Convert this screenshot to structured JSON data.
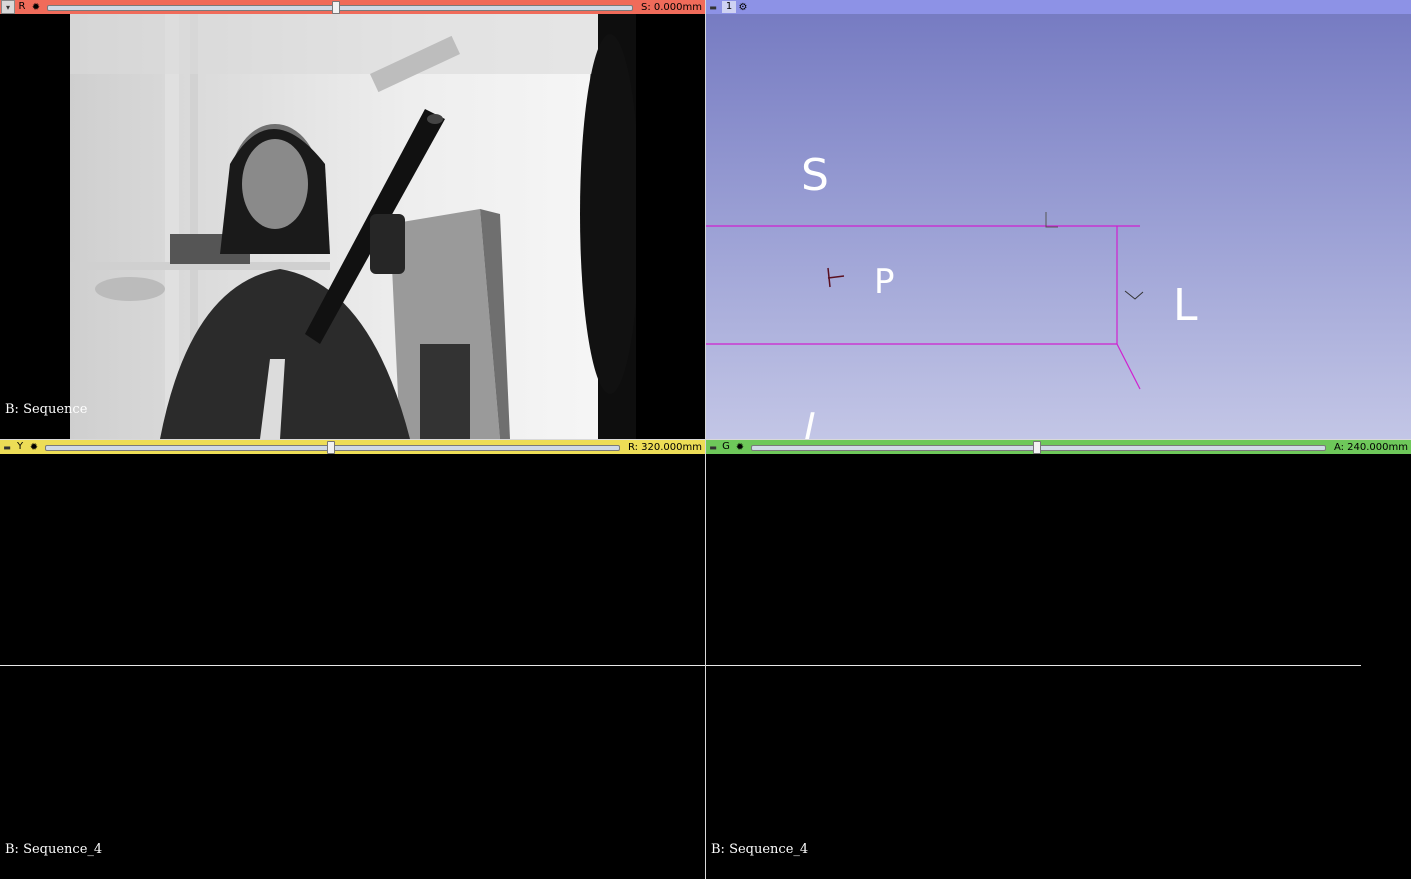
{
  "views": {
    "red": {
      "letter": "R",
      "offset_label": "S: 0.000mm",
      "slider_value": 0.5,
      "bg_label": "B: Sequence",
      "color": "#f06b5a"
    },
    "threed": {
      "letter": "1",
      "color": "#8d92e6",
      "axes": {
        "superior": "S",
        "posterior": "P",
        "left": "L",
        "inferior": "I"
      }
    },
    "yellow": {
      "letter": "Y",
      "offset_label": "R: 320.000mm",
      "slider_value": 0.5,
      "bg_label": "B: Sequence_4",
      "color": "#eddd56"
    },
    "green": {
      "letter": "G",
      "offset_label": "A: 240.000mm",
      "slider_value": 0.5,
      "bg_label": "B: Sequence_4",
      "color": "#6ec85a"
    }
  },
  "icons": {
    "pin": "pin-icon",
    "gear": "gear-icon"
  }
}
